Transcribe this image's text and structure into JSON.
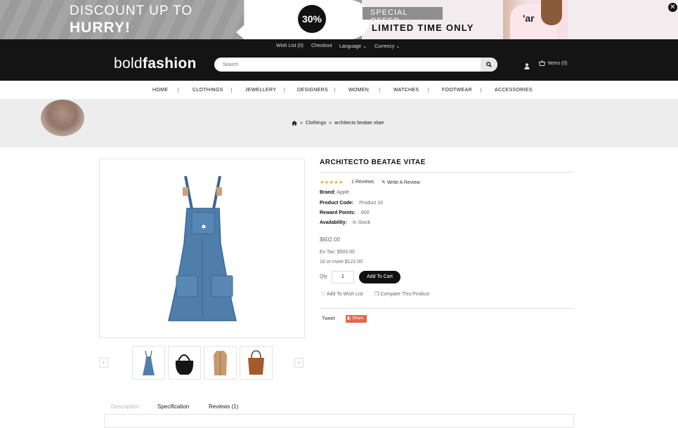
{
  "promo": {
    "line1": "DISCOUNT UP TO",
    "line2": "HURRY!",
    "badge": "30%",
    "special": "SPECIAL OFFER",
    "limited": "LIMITED TIME ONLY",
    "shirt_text": "'ar"
  },
  "topnav": {
    "wishlist": "Wish List (0)",
    "checkout": "Checkout",
    "language": "Language",
    "currency": "Currency"
  },
  "logo": {
    "light": "bold",
    "bold": "fashion"
  },
  "search": {
    "placeholder": "Search"
  },
  "cart": {
    "label": "Items (0)"
  },
  "menu": [
    "HOME",
    "CLOTHINGS",
    "JEWELLERY",
    "DESIGNERS",
    "WOMEN",
    "WATCHES",
    "FOOTWEAR",
    "ACCESSORIES"
  ],
  "breadcrumb": {
    "sep": "»",
    "parent": "Clothings",
    "current": "architecto beatae vitae"
  },
  "product": {
    "title": "ARCHITECTO BEATAE VITAE",
    "stars": "★★★★★",
    "reviews": "1 Reviews",
    "write_review": "Write A Review",
    "brand_label": "Brand:",
    "brand": "Apple",
    "code_label": "Product Code:",
    "code": "Product 16",
    "points_label": "Reward Points:",
    "points": "600",
    "avail_label": "Availability:",
    "avail": "In Stock",
    "price": "$602.00",
    "ex_tax": "Ex Tax: $500.00",
    "discount": "10 or more $122.00",
    "qty_label": "Qty",
    "qty": "1",
    "add_to_cart": "Add To Cart",
    "wishlist": "Add To Wish List",
    "compare": "Compare This Product",
    "tweet": "Tweet",
    "share": "Share"
  },
  "tabs": [
    "Description",
    "Specification",
    "Reviews (1)"
  ],
  "colors": {
    "accent": "#111111",
    "star": "#f5a623",
    "share": "#e8644d"
  }
}
